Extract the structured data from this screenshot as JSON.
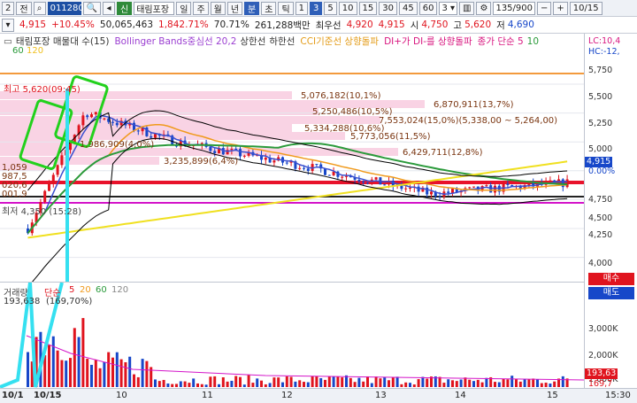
{
  "toolbar": {
    "count_label": "2",
    "all_label": "전",
    "code": "011280",
    "new_label": "신",
    "stock_name": "태림포장",
    "periods": [
      "일",
      "주",
      "월",
      "년",
      "분",
      "초",
      "틱"
    ],
    "minutes": [
      "1",
      "3",
      "5",
      "10",
      "15",
      "30",
      "45",
      "60"
    ],
    "minute_combo": "3",
    "bar_count": "135/900",
    "date_label": "10/15"
  },
  "quote": {
    "price": "4,915",
    "change": "▲ 10.45%",
    "change_value": "+10.45%",
    "volume": "50,065,463",
    "vol_ratio": "1,842.71%",
    "strength": "70.71%",
    "amount": "261,288백만",
    "sell_label": "최우선",
    "ask": "4,920",
    "bid": "4,915",
    "open_label": "시",
    "open": "4,750",
    "high_label": "고",
    "high": "5,620",
    "low_label": "저",
    "low": "4,690"
  },
  "legend": {
    "title": "태림포장 매물대 수(15)",
    "bollinger": "Bollinger Bands중심선 20,2",
    "upper": "상한선",
    "lower": "하한선",
    "cci": "CCI기준선 상향돌파",
    "dmi": "DI+가 DI-를 상향돌파",
    "ma": "종가 단순 5",
    "ma2": "10",
    "side": "LC:10,4",
    "side2": "HC:-12,",
    "ma60": "60",
    "ma120": "120"
  },
  "annotations": {
    "high_mark": "최고 5,620(09:45)",
    "low_mark": "최저 4,350 (15:28)",
    "v1": "5,076,182(10,1%)",
    "v2": "6,870,911(13,7%)",
    "v3": "5,250,486(10,5%)",
    "v4": "7,553,024(15,0%)(5,338,00 ~ 5,264,00)",
    "v5": "5,334,288(10,6%)",
    "v6": "5,773,056(11,5%)",
    "v7": "1,986,909(4,0%)",
    "v8": "6,429,711(12,8%)",
    "v9": "3,235,899(6,4%)",
    "v10": "1,059",
    "v11": "987,5",
    "v12": "020,6",
    "v13": "001,9"
  },
  "volume_pane": {
    "label": "거래량",
    "ma_label": "단순",
    "ma_values": [
      "5",
      "20",
      "60",
      "120"
    ],
    "vol_value": "193,638",
    "vol_pct": "(169,70%)"
  },
  "price_axis": {
    "ticks": [
      "5,750",
      "5,500",
      "5,250",
      "5,000",
      "4,750",
      "4,500",
      "4,250",
      "4,000"
    ],
    "current": "4,915",
    "current_pct": "0.00%"
  },
  "vol_axis": {
    "ticks": [
      "3,000K",
      "2,000K",
      "1,000K"
    ],
    "current": "193,63",
    "current2": "169,7"
  },
  "time_axis": {
    "labels": [
      "10/1",
      "10/15",
      "10",
      "11",
      "12",
      "13",
      "14",
      "15",
      "15:30"
    ]
  },
  "side_buttons": {
    "buy": "매수",
    "sell": "매도"
  },
  "colors": {
    "up": "#e0141e",
    "down": "#1747c9",
    "ma5": "#3a4fcf",
    "ma20": "#f09a1c",
    "ma60": "#2a9a3a",
    "ma120": "#f0e020",
    "band": "#000000",
    "annot_green": "#22d11c",
    "annot_cyan": "#35e0f0",
    "red_line": "#e8122b"
  }
}
